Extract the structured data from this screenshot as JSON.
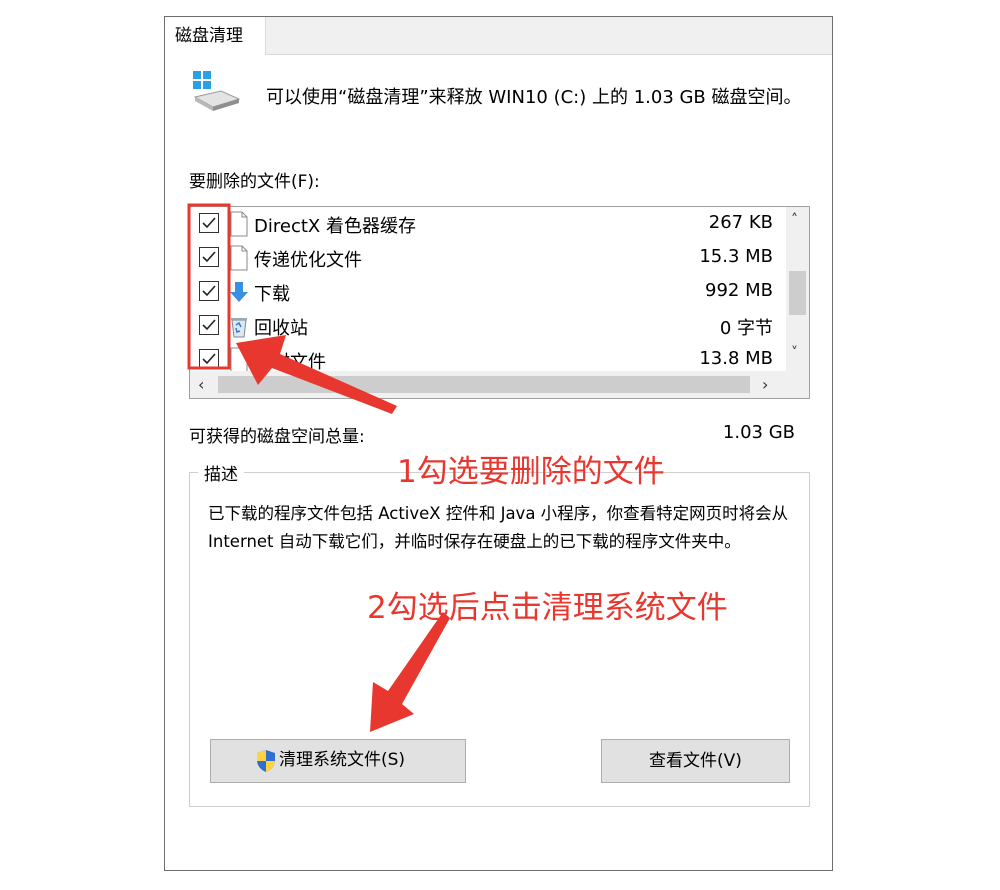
{
  "window": {
    "tab_label": "磁盘清理",
    "intro_text": "可以使用“磁盘清理”来释放 WIN10 (C:) 上的 1.03 GB 磁盘空间。",
    "files_label": "要删除的文件(F):",
    "files": [
      {
        "name": "DirectX 着色器缓存",
        "size": "267 KB",
        "checked": true,
        "icon": "file-icon"
      },
      {
        "name": "传递优化文件",
        "size": "15.3 MB",
        "checked": true,
        "icon": "file-icon"
      },
      {
        "name": "下载",
        "size": "992 MB",
        "checked": true,
        "icon": "download-arrow-icon"
      },
      {
        "name": "回收站",
        "size": "0 字节",
        "checked": true,
        "icon": "recycle-bin-icon"
      },
      {
        "name": "临时文件",
        "size": "13.8 MB",
        "checked": true,
        "icon": "file-icon"
      }
    ],
    "total_label": "可获得的磁盘空间总量:",
    "total_value": "1.03 GB",
    "description": {
      "title": "描述",
      "text": "已下载的程序文件包括 ActiveX 控件和 Java 小程序，你查看特定网页时将会从 Internet 自动下载它们，并临时保存在硬盘上的已下载的程序文件夹中。"
    },
    "buttons": {
      "clean_system_files": "清理系统文件(S)",
      "view_files": "查看文件(V)"
    }
  },
  "annotations": {
    "step1": "1勾选要删除的文件",
    "step2": "2勾选后点击清理系统文件",
    "color": "#e8372f"
  }
}
